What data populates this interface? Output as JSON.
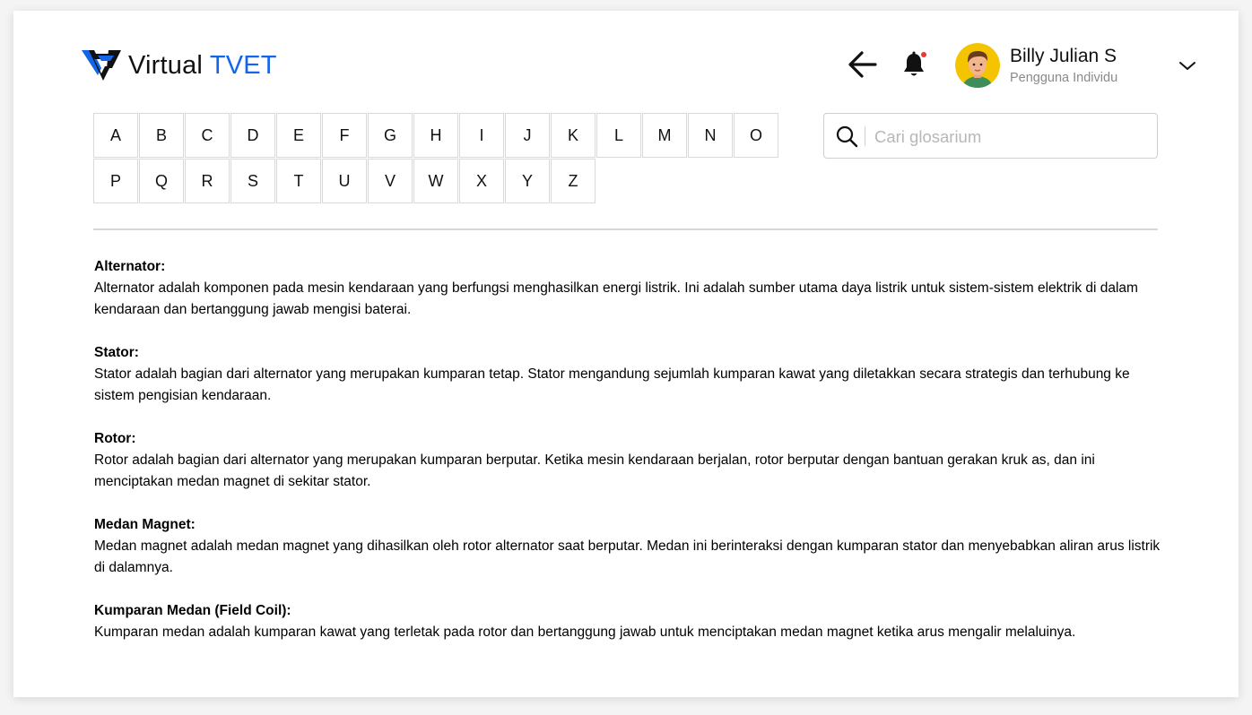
{
  "header": {
    "logo_word1": "Virtual",
    "logo_word2": "TVET",
    "brand_color": "#1565e8",
    "back_icon": "arrow-left-icon",
    "notification_icon": "bell-icon",
    "has_unread_notification": true,
    "user": {
      "name": "Billy Julian S",
      "role": "Pengguna Individu"
    },
    "menu_icon": "chevron-down-icon"
  },
  "alphabet": {
    "row1": [
      "A",
      "B",
      "C",
      "D",
      "E",
      "F",
      "G",
      "H",
      "I",
      "J",
      "K",
      "L",
      "M",
      "N",
      "O"
    ],
    "row2": [
      "P",
      "Q",
      "R",
      "S",
      "T",
      "U",
      "V",
      "W",
      "X",
      "Y",
      "Z"
    ]
  },
  "search": {
    "placeholder": "Cari glosarium",
    "value": ""
  },
  "glossary": [
    {
      "term": "Alternator:",
      "definition": "Alternator adalah komponen pada mesin kendaraan yang berfungsi menghasilkan energi listrik. Ini adalah sumber utama daya listrik untuk sistem-sistem elektrik di dalam kendaraan dan bertanggung jawab mengisi baterai."
    },
    {
      "term": "Stator:",
      "definition": "Stator adalah bagian dari alternator yang merupakan kumparan tetap. Stator mengandung sejumlah kumparan kawat yang diletakkan secara strategis dan terhubung ke sistem pengisian kendaraan."
    },
    {
      "term": "Rotor:",
      "definition": "Rotor adalah bagian dari alternator yang merupakan kumparan berputar. Ketika mesin kendaraan berjalan, rotor berputar dengan bantuan gerakan kruk as, dan ini menciptakan medan magnet di sekitar stator."
    },
    {
      "term": "Medan Magnet:",
      "definition": "Medan magnet adalah medan magnet yang dihasilkan oleh rotor alternator saat berputar. Medan ini berinteraksi dengan kumparan stator dan menyebabkan aliran arus listrik di dalamnya."
    },
    {
      "term": "Kumparan Medan (Field Coil):",
      "definition": "Kumparan medan adalah kumparan kawat yang terletak pada rotor dan bertanggung jawab untuk menciptakan medan magnet ketika arus mengalir melaluinya."
    }
  ]
}
